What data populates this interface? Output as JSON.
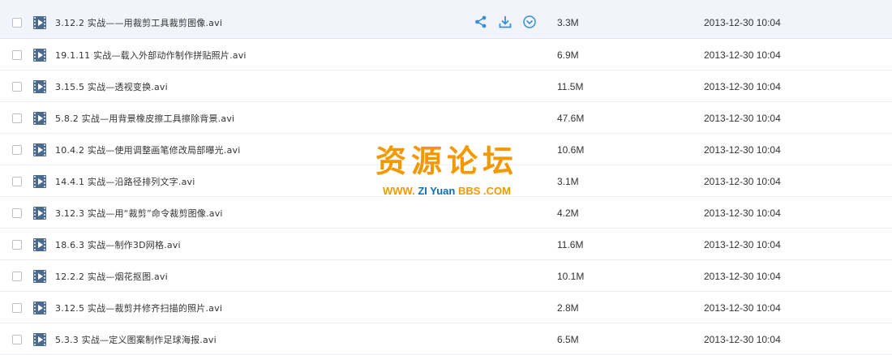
{
  "files": [
    {
      "name": "3.12.2 实战——用裁剪工具裁剪图像.avi",
      "size": "3.3M",
      "date": "2013-12-30 10:04",
      "hovered": true
    },
    {
      "name": "19.1.11 实战—载入外部动作制作拼贴照片.avi",
      "size": "6.9M",
      "date": "2013-12-30 10:04"
    },
    {
      "name": "3.15.5 实战—透视变换.avi",
      "size": "11.5M",
      "date": "2013-12-30 10:04"
    },
    {
      "name": "5.8.2 实战—用背景橡皮擦工具擦除背景.avi",
      "size": "47.6M",
      "date": "2013-12-30 10:04"
    },
    {
      "name": "10.4.2 实战—使用调整画笔修改局部曝光.avi",
      "size": "10.6M",
      "date": "2013-12-30 10:04"
    },
    {
      "name": "14.4.1 实战—沿路径排列文字.avi",
      "size": "3.1M",
      "date": "2013-12-30 10:04"
    },
    {
      "name": "3.12.3 实战—用“裁剪”命令裁剪图像.avi",
      "size": "4.2M",
      "date": "2013-12-30 10:04"
    },
    {
      "name": "18.6.3 实战—制作3D网格.avi",
      "size": "11.6M",
      "date": "2013-12-30 10:04"
    },
    {
      "name": "12.2.2 实战—烟花抠图.avi",
      "size": "10.1M",
      "date": "2013-12-30 10:04"
    },
    {
      "name": "3.12.5 实战—裁剪并修齐扫描的照片.avi",
      "size": "2.8M",
      "date": "2013-12-30 10:04"
    },
    {
      "name": "5.3.3 实战—定义图案制作足球海报.avi",
      "size": "6.5M",
      "date": "2013-12-30 10:04"
    }
  ],
  "hover_actions": [
    "share-icon",
    "download-icon",
    "more-icon"
  ],
  "colors": {
    "accent": "#3b8fd6",
    "watermark_orange": "#f39800",
    "watermark_blue": "#0a6fb8"
  },
  "watermark": {
    "title": "资源论坛",
    "www": "WWW.",
    "zi": "ZI Yuan",
    "bbs": "BBS",
    "com": ".COM"
  }
}
